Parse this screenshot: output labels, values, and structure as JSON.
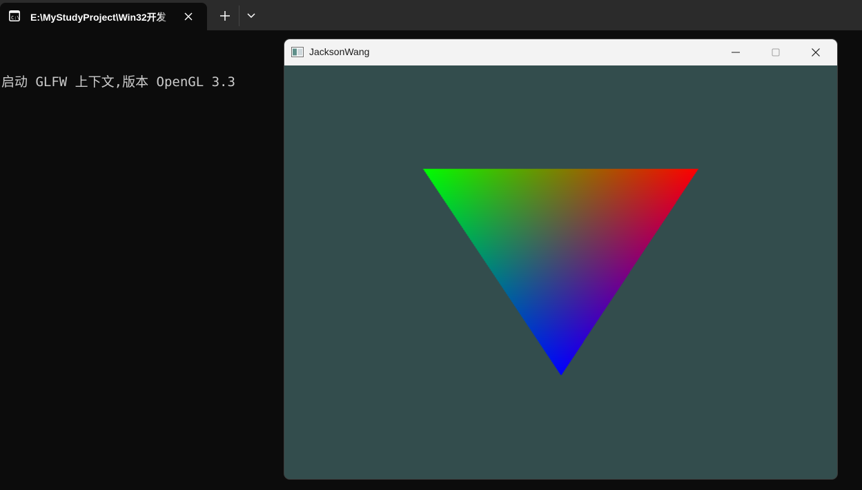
{
  "terminal": {
    "tab_title": "E:\\MyStudyProject\\Win32开发",
    "tab_icon": "console-icon",
    "close_icon": "close-icon",
    "new_tab_icon": "plus-icon",
    "dropdown_icon": "chevron-down-icon",
    "output_lines": [
      "启动 GLFW 上下文,版本 OpenGL 3.3"
    ]
  },
  "gl_window": {
    "title": "JacksonWang",
    "app_icon": "window-app-icon",
    "controls": [
      "minimize-icon",
      "maximize-icon",
      "close-icon"
    ],
    "clear_color": "#334d4d",
    "triangle": {
      "vertex_colors": [
        "#ff0000",
        "#00ff00",
        "#0000ff"
      ]
    }
  }
}
